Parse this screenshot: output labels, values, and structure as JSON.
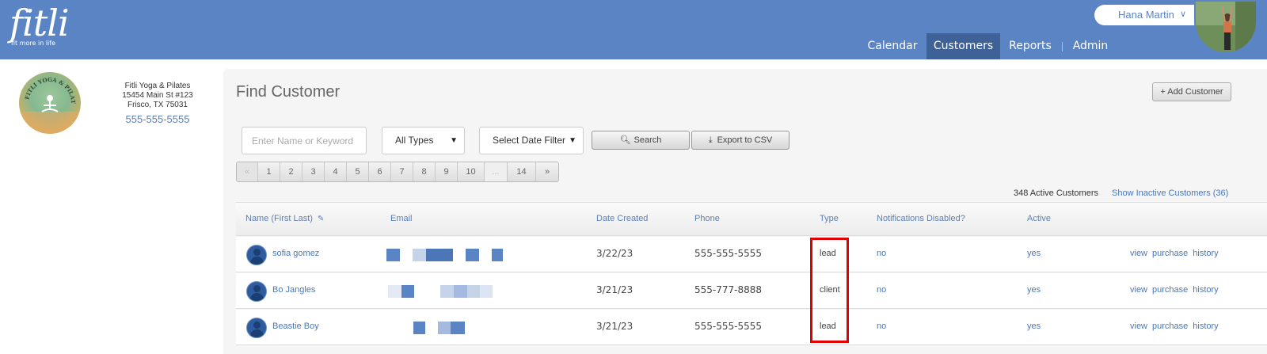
{
  "brand": {
    "name": "fitli",
    "tagline": "fit more in life"
  },
  "user": {
    "name": "Hana Martin",
    "menu_icon": "chevron-down-icon"
  },
  "nav": [
    {
      "label": "Calendar",
      "active": false
    },
    {
      "label": "Customers",
      "active": true
    },
    {
      "label": "Reports",
      "active": false
    },
    {
      "label": "Admin",
      "active": false
    }
  ],
  "studio": {
    "logo_text": "FITLI YOGA & PILATES",
    "name": "Fitli Yoga & Pilates",
    "address1": "15454 Main St #123",
    "address2": "Frisco, TX 75031",
    "phone": "555-555-5555"
  },
  "page": {
    "title": "Find Customer",
    "add_button": "+ Add Customer"
  },
  "filters": {
    "search_placeholder": "Enter Name or Keyword",
    "type_select": "All Types",
    "date_select": "Select Date Filter",
    "search_button": "Search",
    "export_button": "Export to CSV"
  },
  "pagination": [
    "«",
    "1",
    "2",
    "3",
    "4",
    "5",
    "6",
    "7",
    "8",
    "9",
    "10",
    "...",
    "14",
    "»"
  ],
  "summary": {
    "active_count": "348 Active Customers",
    "inactive_link": "Show Inactive Customers (36)"
  },
  "table": {
    "headers": {
      "name": "Name (First Last)",
      "email": "Email",
      "date": "Date Created",
      "phone": "Phone",
      "type": "Type",
      "notifications": "Notifications Disabled?",
      "active": "Active"
    },
    "rows": [
      {
        "name": "sofia gomez",
        "date": "3/22/23",
        "phone": "555-555-5555",
        "type": "lead",
        "notifications": "no",
        "active": "yes"
      },
      {
        "name": "Bo Jangles",
        "date": "3/21/23",
        "phone": "555-777-8888",
        "type": "client",
        "notifications": "no",
        "active": "yes"
      },
      {
        "name": "Beastie Boy",
        "date": "3/21/23",
        "phone": "555-555-5555",
        "type": "lead",
        "notifications": "no",
        "active": "yes"
      }
    ],
    "actions": [
      "view",
      "purchase",
      "history"
    ]
  },
  "colors": {
    "header": "#5b84c4",
    "nav_active": "#3e6198",
    "link": "#4a78b8",
    "highlight": "#e00000"
  }
}
